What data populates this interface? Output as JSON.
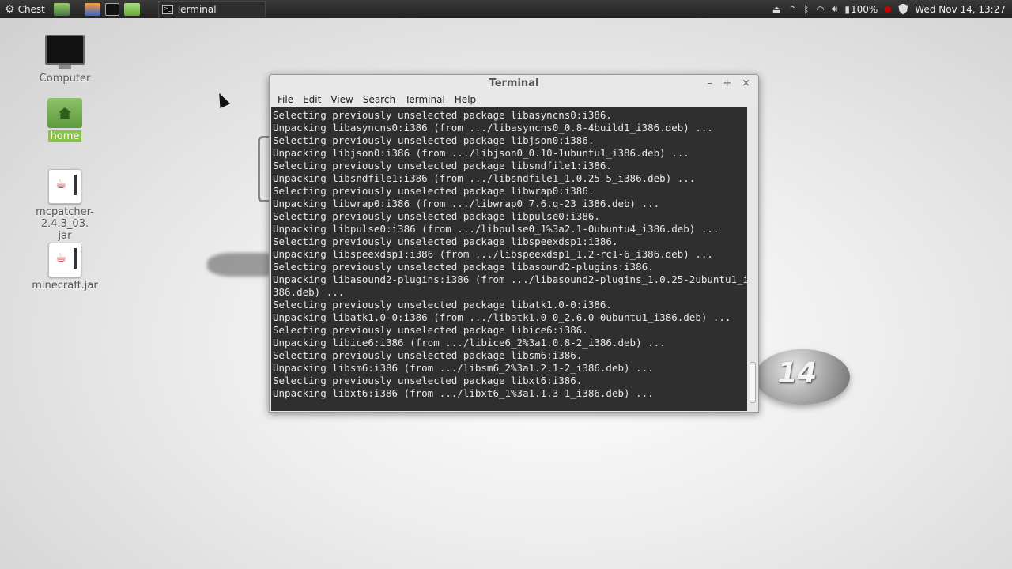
{
  "panel": {
    "menu_label": "Chest",
    "task_terminal_label": "Terminal",
    "battery": "100%",
    "clock": "Wed Nov 14, 13:27"
  },
  "desktop": {
    "computer_label": "Computer",
    "home_label": "home",
    "mcpatcher_label_1": "mcpatcher-2.4.3_03.",
    "mcpatcher_label_2": "jar",
    "minecraft_label": "minecraft.jar"
  },
  "logo_text": "14",
  "terminal": {
    "title": "Terminal",
    "controls": {
      "minimize": "–",
      "maximize": "+",
      "close": "×"
    },
    "menu": [
      "File",
      "Edit",
      "View",
      "Search",
      "Terminal",
      "Help"
    ],
    "lines": [
      "Selecting previously unselected package libasyncns0:i386.",
      "Unpacking libasyncns0:i386 (from .../libasyncns0_0.8-4build1_i386.deb) ...",
      "Selecting previously unselected package libjson0:i386.",
      "Unpacking libjson0:i386 (from .../libjson0_0.10-1ubuntu1_i386.deb) ...",
      "Selecting previously unselected package libsndfile1:i386.",
      "Unpacking libsndfile1:i386 (from .../libsndfile1_1.0.25-5_i386.deb) ...",
      "Selecting previously unselected package libwrap0:i386.",
      "Unpacking libwrap0:i386 (from .../libwrap0_7.6.q-23_i386.deb) ...",
      "Selecting previously unselected package libpulse0:i386.",
      "Unpacking libpulse0:i386 (from .../libpulse0_1%3a2.1-0ubuntu4_i386.deb) ...",
      "Selecting previously unselected package libspeexdsp1:i386.",
      "Unpacking libspeexdsp1:i386 (from .../libspeexdsp1_1.2~rc1-6_i386.deb) ...",
      "Selecting previously unselected package libasound2-plugins:i386.",
      "Unpacking libasound2-plugins:i386 (from .../libasound2-plugins_1.0.25-2ubuntu1_i",
      "386.deb) ...",
      "Selecting previously unselected package libatk1.0-0:i386.",
      "Unpacking libatk1.0-0:i386 (from .../libatk1.0-0_2.6.0-0ubuntu1_i386.deb) ...",
      "Selecting previously unselected package libice6:i386.",
      "Unpacking libice6:i386 (from .../libice6_2%3a1.0.8-2_i386.deb) ...",
      "Selecting previously unselected package libsm6:i386.",
      "Unpacking libsm6:i386 (from .../libsm6_2%3a1.2.1-2_i386.deb) ...",
      "Selecting previously unselected package libxt6:i386.",
      "Unpacking libxt6:i386 (from .../libxt6_1%3a1.1.3-1_i386.deb) ..."
    ]
  }
}
